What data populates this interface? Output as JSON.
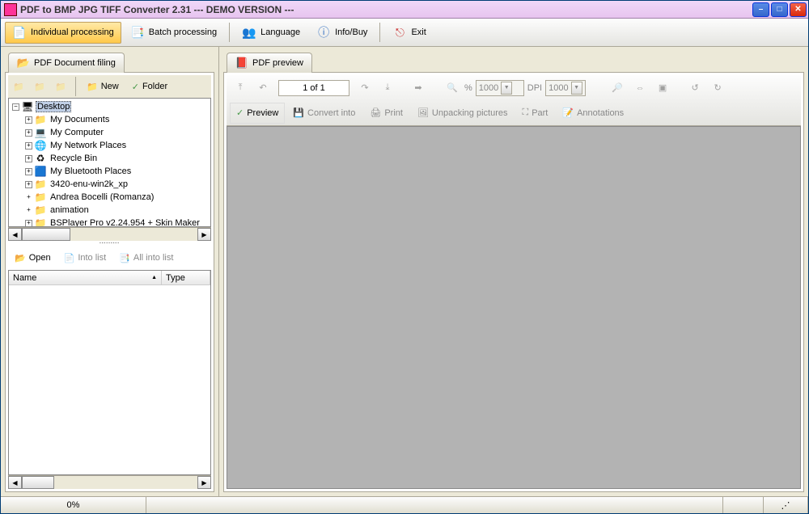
{
  "window_title": "PDF to BMP JPG TIFF Converter 2.31 --- DEMO VERSION ---",
  "main_toolbar": {
    "individual": "Individual processing",
    "batch": "Batch processing",
    "language": "Language",
    "infobuy": "Info/Buy",
    "exit": "Exit"
  },
  "left": {
    "tab": "PDF Document filing",
    "new": "New",
    "folder": "Folder",
    "tree": {
      "root": "Desktop",
      "items": [
        {
          "label": "My Documents",
          "exp": true,
          "icon": "doc"
        },
        {
          "label": "My Computer",
          "exp": true,
          "icon": "comp"
        },
        {
          "label": "My Network Places",
          "exp": true,
          "icon": "net"
        },
        {
          "label": "Recycle Bin",
          "exp": true,
          "icon": "bin"
        },
        {
          "label": "My Bluetooth Places",
          "exp": true,
          "icon": "bt"
        },
        {
          "label": "3420-enu-win2k_xp",
          "exp": true,
          "icon": "fld"
        },
        {
          "label": "Andrea Bocelli (Romanza)",
          "exp": false,
          "icon": "fld"
        },
        {
          "label": "animation",
          "exp": false,
          "icon": "fld"
        },
        {
          "label": "BSPlayer Pro v2.24.954 + Skin Maker",
          "exp": true,
          "icon": "fld"
        }
      ]
    },
    "open": "Open",
    "intolist": "Into list",
    "allintolist": "All into list",
    "col_name": "Name",
    "col_type": "Type"
  },
  "right": {
    "tab": "PDF preview",
    "page": "1 of 1",
    "pctlbl": "%",
    "pctval": "1000",
    "dpilbl": "DPI",
    "dpival": "1000",
    "preview": "Preview",
    "convert": "Convert into",
    "print": "Print",
    "unpack": "Unpacking pictures",
    "part": "Part",
    "annot": "Annotations"
  },
  "status": {
    "progress": "0%"
  }
}
